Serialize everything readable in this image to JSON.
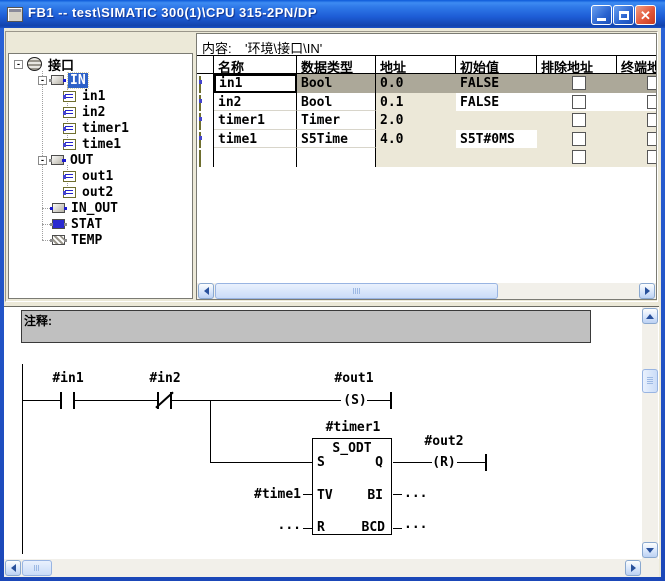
{
  "window": {
    "title": "FB1 -- test\\SIMATIC 300(1)\\CPU 315-2PN/DP",
    "close_icon": "✕"
  },
  "content_header": {
    "label": "内容:",
    "path": "'环境\\接口\\IN'"
  },
  "tree": {
    "items": [
      {
        "label": "接口"
      },
      {
        "label": "IN"
      },
      {
        "label": "in1"
      },
      {
        "label": "in2"
      },
      {
        "label": "timer1"
      },
      {
        "label": "time1"
      },
      {
        "label": "OUT"
      },
      {
        "label": "out1"
      },
      {
        "label": "out2"
      },
      {
        "label": "IN_OUT"
      },
      {
        "label": "STAT"
      },
      {
        "label": "TEMP"
      }
    ],
    "collapse_glyph": "-"
  },
  "table": {
    "columns": [
      "名称",
      "数据类型",
      "地址",
      "初始值",
      "排除地址",
      "终端地址"
    ],
    "rows": [
      {
        "name": "in1",
        "type": "Bool",
        "address": "0.0",
        "initial": "FALSE"
      },
      {
        "name": "in2",
        "type": "Bool",
        "address": "0.1",
        "initial": "FALSE"
      },
      {
        "name": "timer1",
        "type": "Timer",
        "address": "2.0",
        "initial": ""
      },
      {
        "name": "time1",
        "type": "S5Time",
        "address": "4.0",
        "initial": "S5T#0MS"
      },
      {
        "name": "",
        "type": "",
        "address": "",
        "initial": ""
      }
    ]
  },
  "comment": {
    "label": "注释:"
  },
  "ladder": {
    "contact1_label": "#in1",
    "contact2_label": "#in2",
    "coil1_label": "#out1",
    "coil1_symbol": "(S)",
    "coil2_label": "#out2",
    "coil2_symbol": "(R)",
    "timer_label": "#timer1",
    "block_title": "S_ODT",
    "pin_s": "S",
    "pin_q": "Q",
    "pin_tv": "TV",
    "pin_bi": "BI",
    "pin_r": "R",
    "pin_bcd": "BCD",
    "tv_operand": "#time1",
    "r_operand": "...",
    "bi_operand": "...",
    "bcd_operand": "..."
  },
  "colors": {
    "titlebar_blue": "#1d5cd6",
    "selection_blue": "#2e62c8",
    "selected_row_gray": "#aca899",
    "table_beige": "#ece8d8",
    "comment_gray": "#c0c0c0"
  }
}
